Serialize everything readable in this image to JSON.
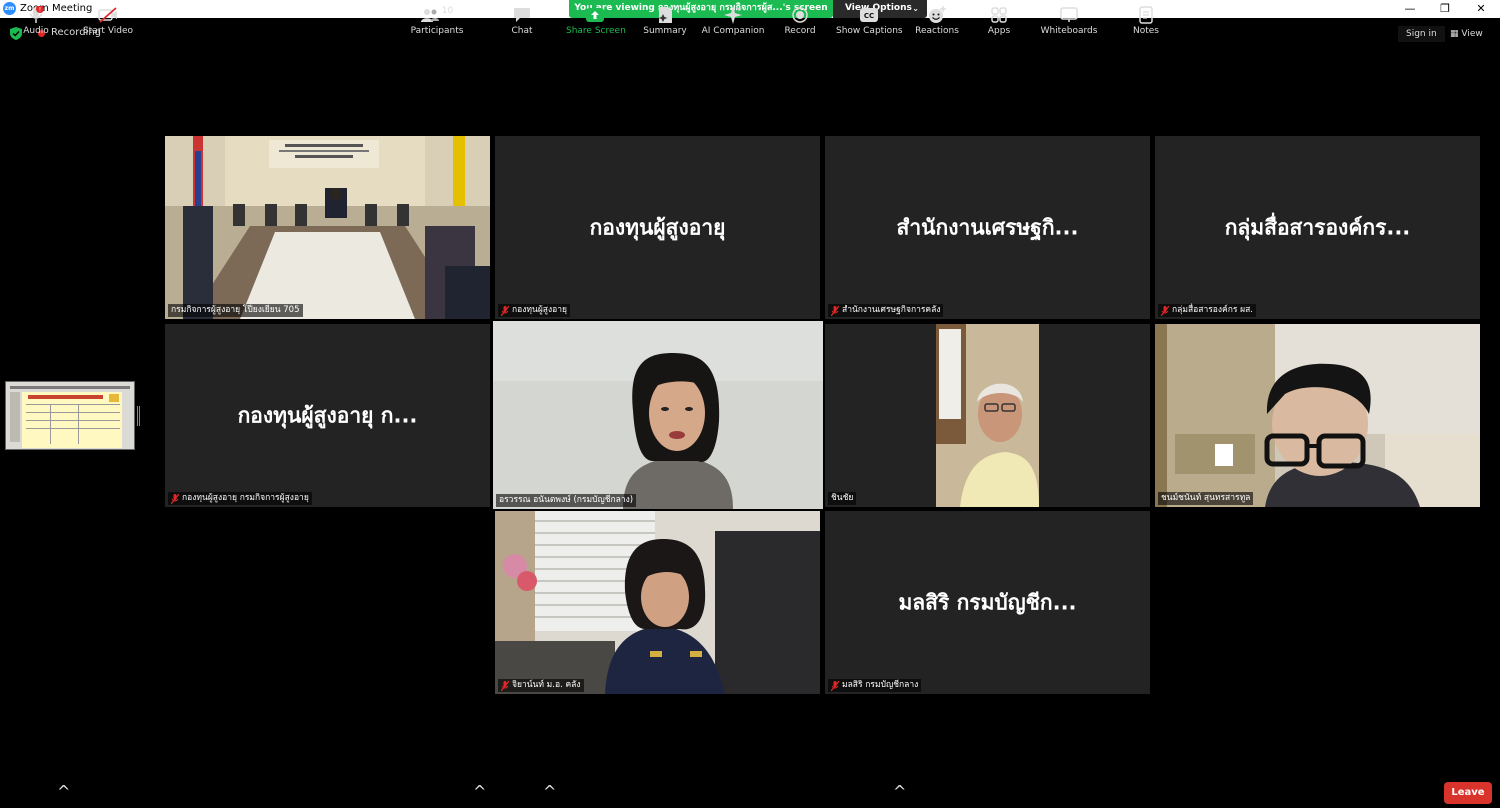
{
  "window": {
    "title": "Zoom Meeting",
    "minimize": "—",
    "restore": "❐",
    "close": "✕"
  },
  "banner": {
    "viewing_text": "You are viewing กองทุนผู้สูงอายุ กรมกิจการผู้ส...'s screen",
    "view_options": "View Options"
  },
  "status": {
    "recording": "Recording",
    "sign_in": "Sign in",
    "view": "View"
  },
  "tiles": [
    {
      "label": "กรมกิจการผู้สูงอายุ โปียงเยียน 705",
      "muted": false,
      "video": "conference-room"
    },
    {
      "name": "กองทุนผู้สูงอายุ",
      "label": "กองทุนผู้สูงอายุ",
      "muted": true
    },
    {
      "name": "สำนักงานเศรษฐกิ...",
      "label": "สำนักงานเศรษฐกิจการคลัง",
      "muted": true
    },
    {
      "name": "กลุ่มสื่อสารองค์กร...",
      "label": "กลุ่มสื่อสารองค์กร ผส.",
      "muted": true
    },
    {
      "name": "กองทุนผู้สูงอายุ ก...",
      "label": "กองทุนผู้สูงอายุ กรมกิจการผู้สูงอายุ",
      "muted": true
    },
    {
      "label": "อรวรรณ อนันตพงษ์ (กรมบัญชีกลาง)",
      "muted": false,
      "video": "woman-speaking",
      "active": true
    },
    {
      "label": "ชินชัย",
      "muted": false,
      "video": "elderly-man"
    },
    {
      "label": "ชนม์ชนันท์ สุนทรสารทูล",
      "muted": false,
      "video": "man-glasses"
    },
    {
      "label": "จิยาน์นท์ ม.อ. คลัง",
      "muted": true,
      "video": "woman-uniform"
    },
    {
      "name": "มลสิริ กรมบัญชีก...",
      "label": "มลสิริ กรมบัญชีกลาง",
      "muted": true
    }
  ],
  "toolbar": {
    "audio": "Audio",
    "start_video": "Start Video",
    "participants": "Participants",
    "participants_count": "10",
    "chat": "Chat",
    "share_screen": "Share Screen",
    "summary": "Summary",
    "ai_companion": "AI Companion",
    "record": "Record",
    "show_captions": "Show Captions",
    "reactions": "Reactions",
    "apps": "Apps",
    "whiteboards": "Whiteboards",
    "notes": "Notes",
    "leave": "Leave",
    "audio_badge": "!"
  },
  "colors": {
    "share_green": "#1cbb52",
    "leave_red": "#d9342b",
    "active_speaker": "#d8e44a",
    "recording_red": "#e02828"
  }
}
